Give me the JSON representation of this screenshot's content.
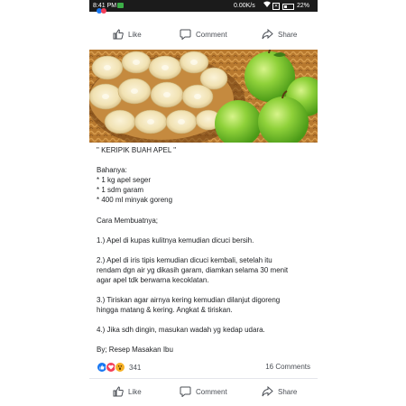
{
  "status_bar": {
    "time": "8:41 PM",
    "speed": "0.00K/s",
    "battery": "22%"
  },
  "actions_top": {
    "like": "Like",
    "comment": "Comment",
    "share": "Share"
  },
  "post": {
    "title": "\" KERIPIK BUAH APEL \"",
    "ingredients_heading": "Bahanya:",
    "ingredients": [
      "* 1 kg apel seger",
      "* 1 sdm garam",
      "* 400 ml minyak goreng"
    ],
    "method_heading": "Cara Membuatnya;",
    "steps": [
      "1.) Apel di kupas kulitnya kemudian dicuci bersih.",
      "2.) Apel di iris tipis kemudian dicuci kembali, setelah itu",
      "rendam dgn air yg dikasih garam, diamkan selama 30 menit",
      "agar apel tdk berwarna kecoklatan.",
      "3.) Tiriskan agar airnya kering kemudian dilanjut digoreng",
      "hingga matang & kering. Angkat & tiriskan.",
      "4.) Jika sdh dingin, masukan wadah yg kedap udara."
    ],
    "credit": "By; Resep Masakan Ibu"
  },
  "reactions": {
    "count": "341",
    "comments": "16 Comments"
  },
  "actions_bottom": {
    "like": "Like",
    "comment": "Comment",
    "share": "Share"
  },
  "colors": {
    "like_blue": "#1877f2",
    "love_red": "#f33e58",
    "wow_yellow": "#f7b125",
    "action_gray": "#4b4f56"
  },
  "icons": [
    "thumbs-up-icon",
    "comment-icon",
    "share-icon",
    "wifi-icon",
    "battery-icon"
  ]
}
